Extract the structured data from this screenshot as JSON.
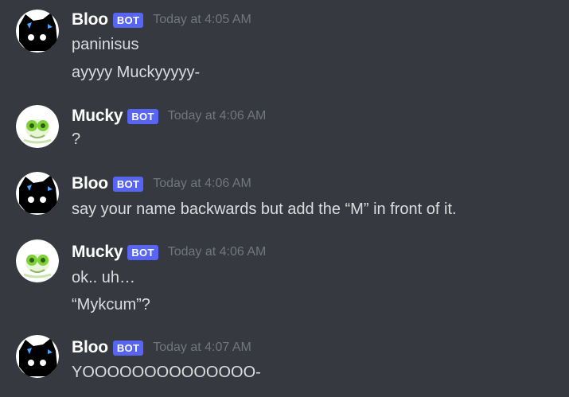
{
  "messages": [
    {
      "author": "Bloo",
      "bot_label": "BOT",
      "timestamp": "Today at 4:05 AM",
      "avatar": "bloo-black-cat-avatar",
      "lines": [
        "paninisus",
        "ayyyy Muckyyyyy-"
      ]
    },
    {
      "author": "Mucky",
      "bot_label": "BOT",
      "timestamp": "Today at 4:06 AM",
      "avatar": "mucky-green-creature-avatar",
      "lines": [
        "?"
      ]
    },
    {
      "author": "Bloo",
      "bot_label": "BOT",
      "timestamp": "Today at 4:06 AM",
      "avatar": "bloo-black-cat-avatar",
      "lines": [
        "say your name backwards but add the “M” in front of it."
      ]
    },
    {
      "author": "Mucky",
      "bot_label": "BOT",
      "timestamp": "Today at 4:06 AM",
      "avatar": "mucky-green-creature-avatar",
      "lines": [
        "ok.. uh…",
        "“Mykcum”?"
      ]
    },
    {
      "author": "Bloo",
      "bot_label": "BOT",
      "timestamp": "Today at 4:07 AM",
      "avatar": "bloo-black-cat-avatar",
      "lines": [
        "YOOOOOOOOOOOOOO-"
      ]
    }
  ],
  "colors": {
    "background": "#36393f",
    "username": "#ffffff",
    "bot_badge": "#5865f2",
    "timestamp": "#72767d",
    "message_text": "#dcddde"
  }
}
